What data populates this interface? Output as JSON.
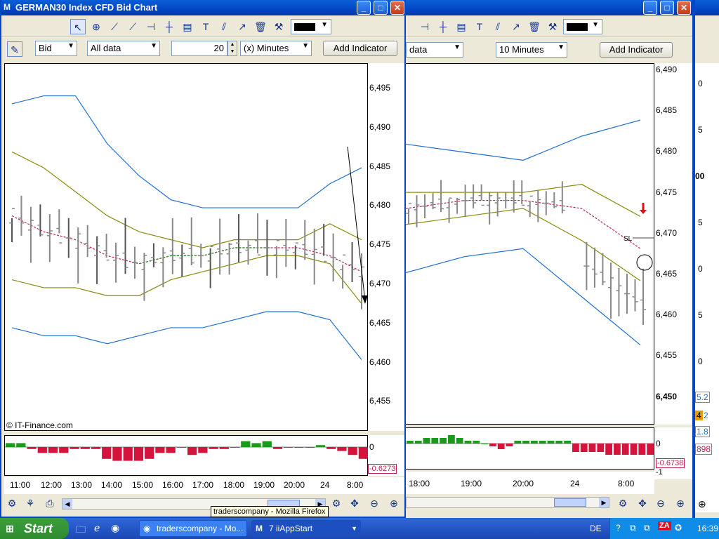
{
  "left_window": {
    "title": "GERMAN30 Index CFD Bid Chart",
    "price_type": "Bid",
    "data_range": "All data",
    "interval_value": "20",
    "interval_unit": "(x) Minutes",
    "add_indicator": "Add Indicator",
    "y_ticks": [
      "6,495",
      "6,490",
      "6,485",
      "6,480",
      "6,475",
      "6,470",
      "6,465",
      "6,460",
      "6,455"
    ],
    "x_ticks": [
      "11:00",
      "12:00",
      "13:00",
      "14:00",
      "15:00",
      "16:00",
      "17:00",
      "18:00",
      "19:00",
      "20:00",
      "24",
      "8:00"
    ],
    "copyright": "© IT-Finance.com",
    "osc_zero": "0",
    "osc_value": "-0.6273"
  },
  "right_window": {
    "data_range": "data",
    "interval": "10 Minutes",
    "add_indicator": "Add Indicator",
    "y_ticks": [
      "6,490",
      "6,485",
      "6,480",
      "6,475",
      "6,470",
      "6,465",
      "6,460",
      "6,455",
      "6,450"
    ],
    "x_ticks": [
      "18:00",
      "19:00",
      "20:00",
      "24",
      "8:00"
    ],
    "osc_zero": "0",
    "osc_value": "-0.6738",
    "osc_minus1": "-1",
    "sl_label": "SL"
  },
  "far_right_fragments": [
    "0",
    "5",
    "00",
    "5",
    "0",
    "5",
    "0",
    "5.2",
    "4",
    "2",
    "1.8",
    "898"
  ],
  "tooltip": "traderscompany - Mozilla Firefox",
  "taskbar": {
    "start": "Start",
    "task1": "traderscompany - Mo...",
    "task2": "7 iiAppStart",
    "lang": "DE",
    "clock": "16:39"
  },
  "colors": {
    "band_outer": "#1f6fd0",
    "band_inner": "#8a8a10",
    "mid_dashed": "#c02050",
    "mid_green": "#228b22",
    "osc_pos": "#1a9a1a",
    "osc_neg": "#d4143c",
    "arrow_red": "#e01010"
  },
  "chart_data": [
    {
      "type": "line",
      "title": "",
      "x": [
        "11:00",
        "12:00",
        "13:00",
        "14:00",
        "15:00",
        "16:00",
        "17:00",
        "18:00",
        "19:00",
        "20:00",
        "24",
        "8:00"
      ],
      "ylim": [
        6452,
        6498
      ],
      "series": [
        {
          "values": [
            6493,
            6494,
            6494,
            6488,
            6484,
            6481,
            6480,
            6480,
            6480,
            6480,
            6483,
            6485
          ]
        },
        {
          "values": [
            6487,
            6485,
            6482,
            6479,
            6477,
            6476,
            6475,
            6476,
            6476,
            6476,
            6478,
            6476
          ]
        },
        {
          "values": [
            6479,
            6477,
            6476,
            6474,
            6473,
            6474,
            6474,
            6475,
            6475,
            6475,
            6474,
            6472
          ]
        },
        {
          "values": [
            6471,
            6470,
            6470,
            6469,
            6469,
            6471,
            6472,
            6473,
            6474,
            6474,
            6473,
            6468
          ]
        },
        {
          "values": [
            6465,
            6464,
            6464,
            6463,
            6464,
            6465,
            6465,
            6466,
            6467,
            6467,
            6466,
            6461
          ]
        }
      ]
    },
    {
      "type": "bar",
      "title": "",
      "values": [
        0.2,
        0.2,
        -0.1,
        -0.3,
        -0.3,
        -0.3,
        -0.1,
        -0.1,
        -0.1,
        -0.6,
        -0.7,
        -0.7,
        -0.7,
        -0.6,
        -0.3,
        -0.3,
        0,
        -0.4,
        -0.3,
        -0.1,
        -0.1,
        0,
        0.3,
        0.2,
        0.3,
        -0.1,
        0,
        0,
        0,
        0.1,
        -0.1,
        -0.2,
        -0.4,
        -0.6
      ]
    },
    {
      "type": "line",
      "title": "",
      "x": [
        "18:00",
        "19:00",
        "20:00",
        "24",
        "8:00"
      ],
      "ylim": [
        6447,
        6492
      ],
      "series": [
        {
          "values": [
            6482,
            6481,
            6480,
            6483,
            6485
          ]
        },
        {
          "values": [
            6476,
            6476,
            6476,
            6477,
            6473
          ]
        },
        {
          "values": [
            6474,
            6475,
            6475,
            6474,
            6469
          ]
        },
        {
          "values": [
            6472,
            6473,
            6474,
            6470,
            6465
          ]
        },
        {
          "values": [
            6466,
            6468,
            6469,
            6463,
            6457
          ]
        }
      ]
    },
    {
      "type": "bar",
      "title": "",
      "values": [
        0.1,
        0.1,
        0.2,
        0.2,
        0.2,
        0.3,
        0.2,
        0.1,
        0.1,
        0,
        -0.1,
        -0.2,
        -0.1,
        0.1,
        0.1,
        0.1,
        0.1,
        0.1,
        0.1,
        0.1,
        -0.3,
        -0.3,
        -0.3,
        -0.3,
        -0.4,
        -0.4,
        -0.4,
        -0.4,
        -0.4,
        -0.4
      ]
    }
  ]
}
